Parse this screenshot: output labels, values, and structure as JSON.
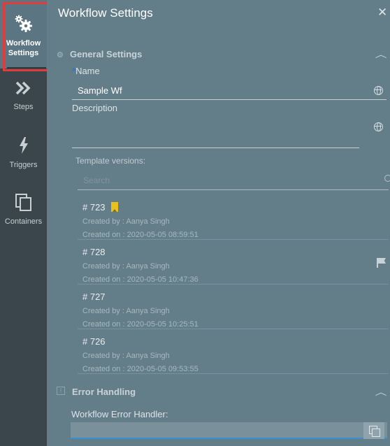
{
  "rail": {
    "items": [
      {
        "label_line1": "Workflow",
        "label_line2": "Settings",
        "icon": "gears-icon",
        "active": true
      },
      {
        "label": "Steps",
        "icon": "double-chevron-icon"
      },
      {
        "label": "Triggers",
        "icon": "lightning-icon"
      },
      {
        "label": "Containers",
        "icon": "containers-icon"
      }
    ]
  },
  "panel": {
    "title": "Workflow Settings",
    "close_glyph": "✕"
  },
  "general": {
    "heading": "General Settings",
    "name_required_mark": "*",
    "name_label": "Name",
    "name_value": "Sample Wf",
    "description_label": "Description",
    "description_value": "",
    "template_versions_label": "Template versions:",
    "search_placeholder": "Search"
  },
  "versions": [
    {
      "number": "# 723",
      "created_by": "Created by : Aanya Singh",
      "created_on": "Created on : 2020-05-05 08:59:51",
      "bookmarked": true
    },
    {
      "number": "# 728",
      "created_by": "Created by : Aanya Singh",
      "created_on": "Created on : 2020-05-05 10:47:36",
      "flag": true
    },
    {
      "number": "# 727",
      "created_by": "Created by : Aanya Singh",
      "created_on": "Created on : 2020-05-05 10:25:51"
    },
    {
      "number": "# 726",
      "created_by": "Created by : Aanya Singh",
      "created_on": "Created on : 2020-05-05 09:53:55"
    }
  ],
  "error": {
    "heading": "Error Handling",
    "handler_label": "Workflow Error Handler:",
    "handler_value": ""
  },
  "colors": {
    "highlight": "#e23b3b",
    "accent": "#3b8fd0",
    "bookmark": "#e8c21b"
  }
}
